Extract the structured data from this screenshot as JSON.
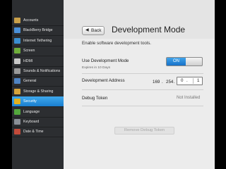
{
  "sidebar": {
    "items": [
      {
        "label": "Accounts",
        "icon": "accounts-icon",
        "color": "#c9a04a"
      },
      {
        "label": "BlackBerry Bridge",
        "icon": "blackberry-bridge-icon",
        "color": "#4a90d9"
      },
      {
        "label": "Internet Tethering",
        "icon": "internet-tethering-icon",
        "color": "#3b8fd1"
      },
      {
        "label": "Screen",
        "icon": "screen-icon",
        "color": "#6fae3b"
      },
      {
        "label": "HDMI",
        "icon": "hdmi-icon",
        "color": "#c9c9c9"
      },
      {
        "label": "Sounds & Notifications",
        "icon": "sounds-icon",
        "color": "#9a9a9a"
      },
      {
        "label": "General",
        "icon": "general-icon",
        "color": "#4f84c4"
      },
      {
        "label": "Storage & Sharing",
        "icon": "storage-icon",
        "color": "#d6a33a"
      },
      {
        "label": "Security",
        "icon": "lock-icon",
        "color": "#e0b020",
        "active": true
      },
      {
        "label": "Language",
        "icon": "language-icon",
        "color": "#53a83d"
      },
      {
        "label": "Keyboard",
        "icon": "keyboard-icon",
        "color": "#8a8f96"
      },
      {
        "label": "Date & Time",
        "icon": "clock-icon",
        "color": "#c24a3a"
      }
    ]
  },
  "header": {
    "back_label": "Back",
    "title": "Development Mode"
  },
  "main": {
    "subtitle": "Enable software development tools.",
    "dev_mode_label": "Use Development Mode",
    "dev_mode_expiry": "Expires in 10 Days",
    "dev_mode_toggle": "ON",
    "address_label": "Development Address",
    "address_octets": [
      "169",
      "254",
      "0",
      "1"
    ],
    "token_label": "Debug Token",
    "token_status": "Not Installed",
    "remove_button": "Remove Debug Token"
  },
  "colors": {
    "accent": "#1a7ed0",
    "background": "#ececec"
  }
}
